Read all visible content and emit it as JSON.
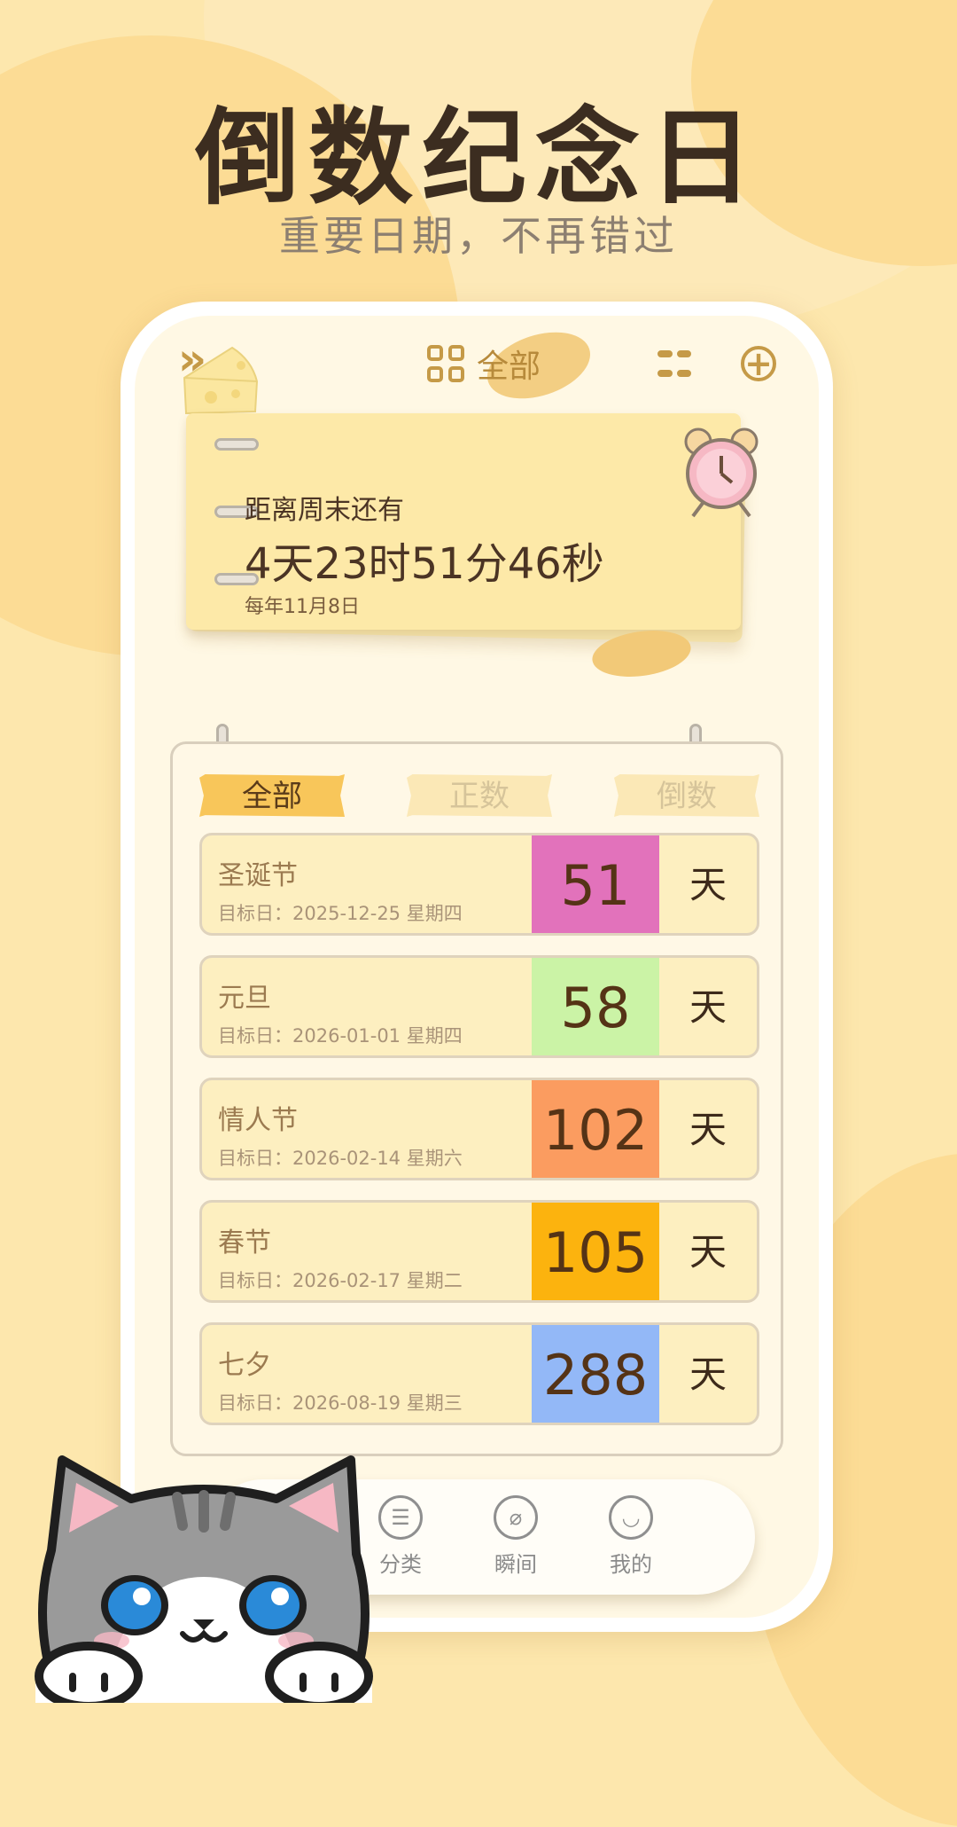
{
  "promo": {
    "title": "倒数纪念日",
    "subtitle": "重要日期，不再错过"
  },
  "topbar": {
    "category_label": "全部"
  },
  "highlight": {
    "label": "距离周末还有",
    "countdown": "4天23时51分46秒",
    "repeat": "每年11月8日"
  },
  "tabs": [
    {
      "label": "全部",
      "active": true
    },
    {
      "label": "正数",
      "active": false
    },
    {
      "label": "倒数",
      "active": false
    }
  ],
  "events": [
    {
      "name": "圣诞节",
      "date": "目标日：2025-12-25 星期四",
      "days": "51",
      "unit": "天",
      "color": "#e272bb"
    },
    {
      "name": "元旦",
      "date": "目标日：2026-01-01 星期四",
      "days": "58",
      "unit": "天",
      "color": "#cbf3a6"
    },
    {
      "name": "情人节",
      "date": "目标日：2026-02-14 星期六",
      "days": "102",
      "unit": "天",
      "color": "#fb9c60"
    },
    {
      "name": "春节",
      "date": "目标日：2026-02-17 星期二",
      "days": "105",
      "unit": "天",
      "color": "#fcb30e"
    },
    {
      "name": "七夕",
      "date": "目标日：2026-08-19 星期三",
      "days": "288",
      "unit": "天",
      "color": "#93b8f7"
    }
  ],
  "nav": [
    {
      "label": "分类",
      "icon": "list-icon"
    },
    {
      "label": "瞬间",
      "icon": "compass-icon"
    },
    {
      "label": "我的",
      "icon": "smile-icon"
    }
  ]
}
